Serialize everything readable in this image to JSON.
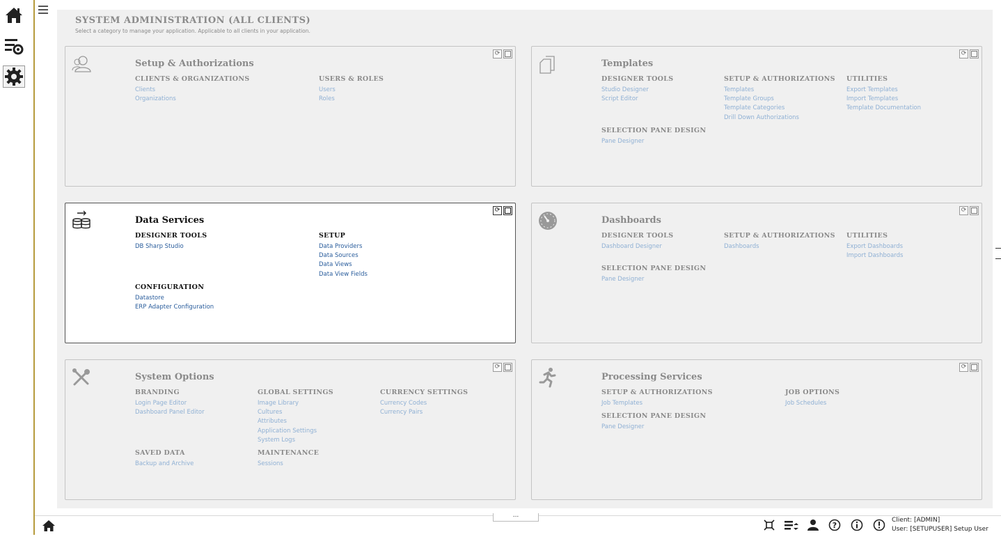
{
  "page": {
    "title": "SYSTEM ADMINISTRATION (ALL CLIENTS)",
    "subtitle": "Select a category to manage your application. Applicable to all clients in your application."
  },
  "panels": {
    "setup": {
      "title": "Setup & Authorizations",
      "icon": "users-icon",
      "groups": [
        {
          "head": "CLIENTS & ORGANIZATIONS",
          "links": [
            "Clients",
            "Organizations"
          ]
        },
        {
          "head": "USERS & ROLES",
          "links": [
            "Users",
            "Roles"
          ]
        }
      ]
    },
    "templates": {
      "title": "Templates",
      "icon": "documents-icon",
      "groups": [
        {
          "head": "DESIGNER TOOLS",
          "links": [
            "Studio Designer",
            "Script Editor"
          ]
        },
        {
          "head": "SETUP & AUTHORIZATIONS",
          "links": [
            "Templates",
            "Template Groups",
            "Template Categories",
            "Drill Down Authorizations"
          ]
        },
        {
          "head": "UTILITIES",
          "links": [
            "Export Templates",
            "Import Templates",
            "Template Documentation"
          ]
        },
        {
          "head": "SELECTION PANE DESIGN",
          "links": [
            "Pane Designer"
          ]
        }
      ]
    },
    "data": {
      "title": "Data Services",
      "icon": "database-icon",
      "groups": [
        {
          "head": "DESIGNER TOOLS",
          "links": [
            "DB Sharp Studio"
          ]
        },
        {
          "head": "SETUP",
          "links": [
            "Data Providers",
            "Data Sources",
            "Data Views",
            "Data View Fields"
          ]
        },
        {
          "head": "CONFIGURATION",
          "links": [
            "Datastore",
            "ERP Adapter Configuration"
          ]
        }
      ]
    },
    "dashboards": {
      "title": "Dashboards",
      "icon": "gauge-icon",
      "groups": [
        {
          "head": "DESIGNER TOOLS",
          "links": [
            "Dashboard Designer"
          ]
        },
        {
          "head": "SETUP & AUTHORIZATIONS",
          "links": [
            "Dashboards"
          ]
        },
        {
          "head": "UTILITIES",
          "links": [
            "Export Dashboards",
            "Import Dashboards"
          ]
        },
        {
          "head": "SELECTION PANE DESIGN",
          "links": [
            "Pane Designer"
          ]
        }
      ]
    },
    "system": {
      "title": "System Options",
      "icon": "tools-icon",
      "groups": [
        {
          "head": "BRANDING",
          "links": [
            "Login Page Editor",
            "Dashboard Panel Editor"
          ]
        },
        {
          "head": "GLOBAL SETTINGS",
          "links": [
            "Image Library",
            "Cultures",
            "Attributes",
            "Application Settings",
            "System Logs"
          ]
        },
        {
          "head": "CURRENCY SETTINGS",
          "links": [
            "Currency Codes",
            "Currency Pairs"
          ]
        },
        {
          "head": "SAVED DATA",
          "links": [
            "Backup and Archive"
          ]
        },
        {
          "head": "MAINTENANCE",
          "links": [
            "Sessions"
          ]
        }
      ]
    },
    "processing": {
      "title": "Processing Services",
      "icon": "runner-icon",
      "groups": [
        {
          "head": "SETUP & AUTHORIZATIONS",
          "links": [
            "Job Templates"
          ]
        },
        {
          "head": "JOB OPTIONS",
          "links": [
            "Job Schedules"
          ]
        },
        {
          "head": "SELECTION PANE DESIGN",
          "links": [
            "Pane Designer"
          ]
        }
      ]
    }
  },
  "bottombar": {
    "more_label": "...",
    "client_line": "Client: [ADMIN]",
    "user_line": "User: [SETUPUSER] Setup User"
  },
  "colors": {
    "rail_accent": "#b59a3c",
    "link_inactive": "#8fb0d4",
    "link_active": "#2a5d9c"
  }
}
